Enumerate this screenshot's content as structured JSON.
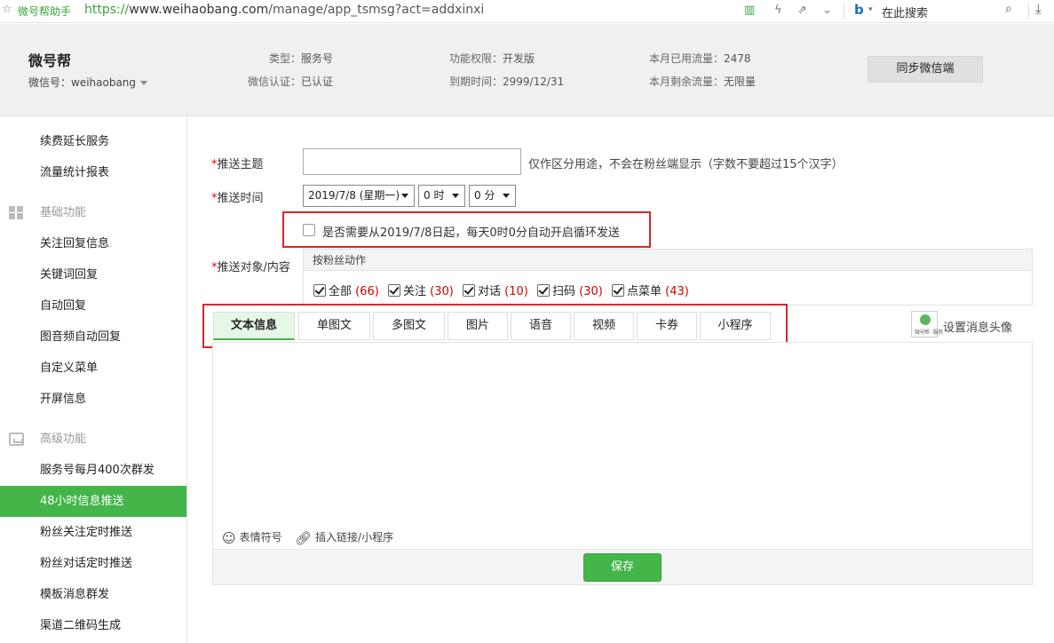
{
  "browser": {
    "site_name": "微号帮助手",
    "url_proto": "https://",
    "url_host": "www.weihaobang.com",
    "url_path": "/manage/app_tsmsg?act=addxinxi",
    "search_label": "在此搜索"
  },
  "account": {
    "name": "微号帮",
    "id_label": "微信号：weihaobang",
    "type_label": "类型：",
    "type_value": "服务号",
    "verify_label": "微信认证：",
    "verify_value": "已认证",
    "perm_label": "功能权限：",
    "perm_value": "开发版",
    "expire_label": "到期时间：",
    "expire_value": "2999/12/31",
    "used_label": "本月已用流量：",
    "used_value": "2478",
    "remain_label": "本月剩余流量：",
    "remain_value": "无限量",
    "sync_button": "同步微信端"
  },
  "sidebar": {
    "items_top": [
      "续费延长服务",
      "流量统计报表"
    ],
    "section_basic": "基础功能",
    "items_basic": [
      "关注回复信息",
      "关键词回复",
      "自动回复",
      "图音频自动回复",
      "自定义菜单",
      "开屏信息"
    ],
    "section_advanced": "高级功能",
    "items_advanced": [
      "服务号每月400次群发",
      "48小时信息推送",
      "粉丝关注定时推送",
      "粉丝对话定时推送",
      "模板消息群发",
      "渠道二维码生成"
    ]
  },
  "form": {
    "required_mark": "*",
    "topic_label": "推送主题",
    "topic_value": "",
    "topic_hint": "仅作区分用途，不会在粉丝端显示（字数不要超过15个汉字）",
    "time_label": "推送时间",
    "date_select": "2019/7/8 (星期一)",
    "hour_select": "0 时",
    "minute_select": "0 分",
    "loop_text": "是否需要从2019/7/8日起，每天0时0分自动开启循环发送",
    "loop_checked": false,
    "target_label": "推送对象/内容",
    "target_head": "按粉丝动作",
    "targets": [
      {
        "label": "全部",
        "count": "(66)"
      },
      {
        "label": "关注",
        "count": "(30)"
      },
      {
        "label": "对话",
        "count": "(10)"
      },
      {
        "label": "扫码",
        "count": "(30)"
      },
      {
        "label": "点菜单",
        "count": "(43)"
      }
    ]
  },
  "tabs": [
    "文本信息",
    "单图文",
    "多图文",
    "图片",
    "语音",
    "视频",
    "卡券",
    "小程序"
  ],
  "avatar": {
    "tiny_text": "微号帮 · 服务",
    "label": "设置消息头像"
  },
  "editor": {
    "emoji_label": "表情符号",
    "link_label": "插入链接/小程序",
    "save_button": "保存"
  },
  "colors": {
    "accent": "#44b549",
    "highlight_box": "#d8262a",
    "count_red": "#c00000"
  }
}
